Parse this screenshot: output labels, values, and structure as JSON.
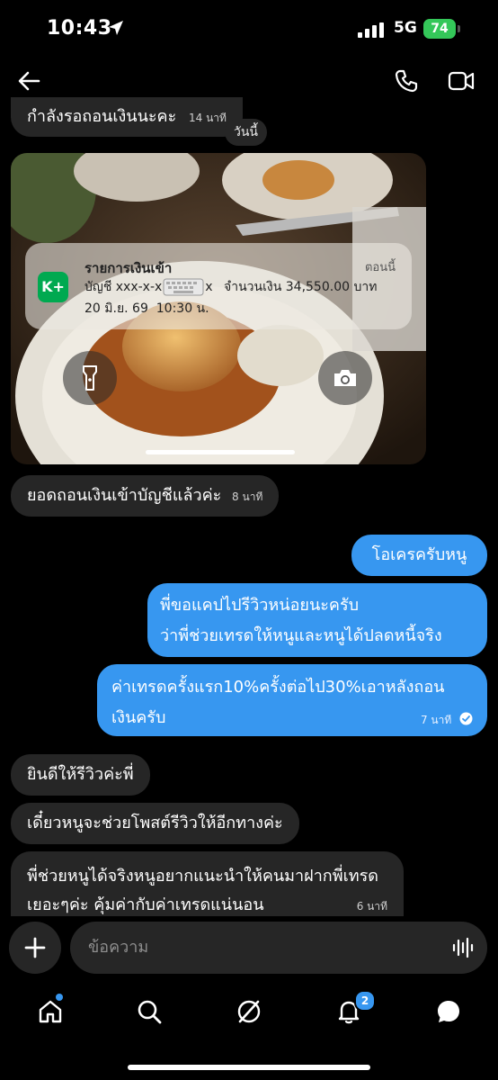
{
  "status_bar": {
    "time": "10:43",
    "network": "5G",
    "battery": "74"
  },
  "messages": {
    "m1_text": "กำลังรอถอนเงินนะคะ",
    "m1_time": "14 นาที",
    "date_separator": "วันนี้",
    "m2_text": "ยอดถอนเงินเข้าบัญชีแล้วค่ะ",
    "m2_time": "8 นาที",
    "m3_text": "โอเครครับหนู",
    "m4_line1": "พี่ขอแคปไปรีวิวหน่อยนะครับ",
    "m4_line2": "ว่าพี่ช่วยเทรดให้หนูและหนูได้ปลดหนี้จริง",
    "m5_line1": "ค่าเทรดครั้งแรก10%ครั้งต่อไป30%เอาหลังถอน",
    "m5_line2": "เงินครับ",
    "m5_time": "7 นาที",
    "m6_text": "ยินดีให้รีวิวค่ะพี่",
    "m7_text": "เดี๋ยวหนูจะช่วยโพสต์รีวิวให้อีกทางค่ะ",
    "m8_line1": "พี่ช่วยหนูได้จริงหนูอยากแนะนำให้คนมาฝากพี่เทรด",
    "m8_line2": "เยอะๆค่ะ คุ้มค่ากับค่าเทรดแน่นอน",
    "m8_time": "6 นาที"
  },
  "notification": {
    "app_badge": "K+",
    "title": "รายการเงินเข้า",
    "when": "ตอนนี้",
    "account_label": "บัญชี xxx-x-x",
    "account_tail": "x",
    "amount_text": "จำนวนเงิน 34,550.00 บาท",
    "datetime": "20 มิ.ย. 69  10:30 น."
  },
  "composer": {
    "placeholder": "ข้อความ"
  },
  "tabbar": {
    "notification_badge": "2"
  },
  "colors": {
    "outgoing": "#3797f0",
    "incoming": "#262626",
    "kplus": "#00a950",
    "battery": "#34c759"
  }
}
